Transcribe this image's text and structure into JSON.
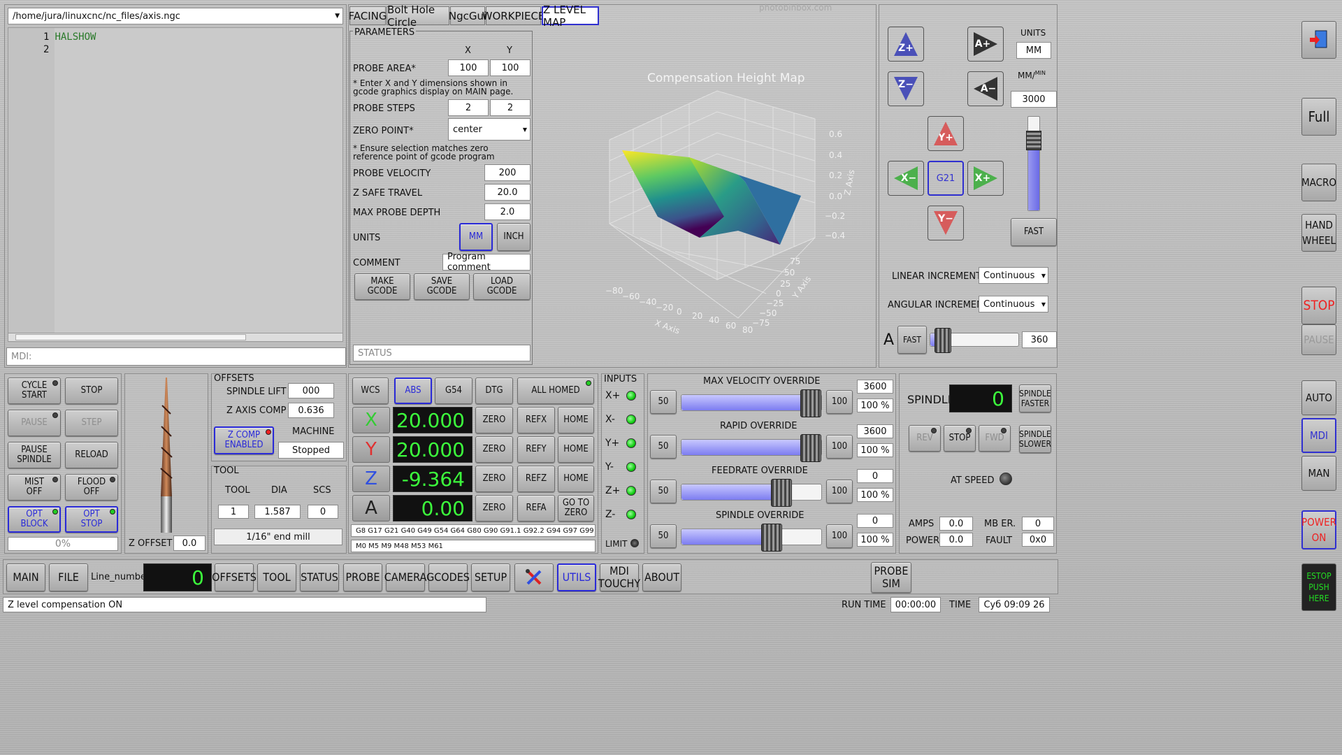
{
  "editor": {
    "path": "/home/jura/linuxcnc/nc_files/axis.ngc",
    "line1_num": "1",
    "line1_text": "HALSHOW",
    "line2_num": "2",
    "mdi_placeholder": "MDI:"
  },
  "tabs": [
    "FACING",
    "Bolt Hole Circle",
    "NgcGui",
    "WORKPIECE",
    "Z LEVEL MAP"
  ],
  "params": {
    "header": "PARAMETERS",
    "col_x": "X",
    "col_y": "Y",
    "probe_area_label": "PROBE AREA*",
    "probe_area_x": "100",
    "probe_area_y": "100",
    "note1": "* Enter X and Y dimensions shown in gcode graphics display on MAIN page.",
    "probe_steps_label": "PROBE STEPS",
    "probe_steps_x": "2",
    "probe_steps_y": "2",
    "zero_point_label": "ZERO POINT*",
    "zero_point_value": "center",
    "note2": "* Ensure selection matches zero reference point of gcode program",
    "probe_velocity_label": "PROBE VELOCITY",
    "probe_velocity": "200",
    "z_safe_label": "Z SAFE TRAVEL",
    "z_safe": "20.0",
    "max_depth_label": "MAX PROBE DEPTH",
    "max_depth": "2.0",
    "units_label": "UNITS",
    "mm": "MM",
    "inch": "INCH",
    "comment_label": "COMMENT",
    "comment_value": "Program comment",
    "make": "MAKE\nGCODE",
    "save": "SAVE\nGCODE",
    "load": "LOAD\nGCODE",
    "status_placeholder": "STATUS"
  },
  "plot": {
    "title": "Compensation Height Map",
    "watermark": "photobinbox.com",
    "z_axis": "Z Axis",
    "y_axis": "Y Axis",
    "x_axis": "X Axis",
    "z_ticks": [
      "0.6",
      "0.4",
      "0.2",
      "0.0",
      "−0.2",
      "−0.4"
    ],
    "x_ticks": [
      "−80",
      "−60",
      "−40",
      "−20",
      "0",
      "20",
      "40",
      "60",
      "80"
    ],
    "y_ticks": [
      "75",
      "50",
      "25",
      "0",
      "−25",
      "−50",
      "−75"
    ]
  },
  "jog": {
    "z_plus": "Z+",
    "z_minus": "Z−",
    "a_plus": "A+",
    "a_minus": "A−",
    "y_plus": "Y+",
    "y_minus": "Y−",
    "x_plus": "X+",
    "x_minus": "X−",
    "g21": "G21",
    "units_label": "UNITS",
    "units_value": "MM",
    "rate_label": "MM/",
    "rate_sup": "MIN",
    "rate_value": "3000",
    "fast": "FAST",
    "linear_label": "LINEAR INCREMENT",
    "linear_value": "Continuous",
    "angular_label": "ANGULAR INCREMENT",
    "angular_value": "Continuous",
    "a_label": "A",
    "a_fast": "FAST",
    "a_value": "360"
  },
  "side": {
    "full": "Full",
    "macro": "MACRO",
    "handwheel": "HAND\nWHEEL",
    "stop": "STOP",
    "pause": "PAUSE",
    "auto": "AUTO",
    "mdi": "MDI",
    "man": "MAN",
    "power": "POWER\nON",
    "estop": "ESTOP\nPUSH\nHERE"
  },
  "controls": {
    "cycle_start": "CYCLE\nSTART",
    "stop": "STOP",
    "pause": "PAUSE",
    "step": "STEP",
    "pause_spindle": "PAUSE\nSPINDLE",
    "reload": "RELOAD",
    "mist": "MIST\nOFF",
    "flood": "FLOOD\nOFF",
    "opt_block": "OPT\nBLOCK",
    "opt_stop": "OPT\nSTOP",
    "progress": "0%",
    "z_offset_label": "Z OFFSET",
    "z_offset": "0.0"
  },
  "offsets": {
    "header": "OFFSETS",
    "spindle_lift_label": "SPINDLE LIFT",
    "spindle_lift": "000",
    "z_comp_label": "Z AXIS COMP",
    "z_comp": "0.636",
    "z_comp_btn": "Z COMP\nENABLED",
    "machine_label": "MACHINE",
    "machine_state": "Stopped",
    "tool_header": "TOOL",
    "tool_col": "TOOL",
    "dia_col": "DIA",
    "scs_col": "SCS",
    "tool": "1",
    "dia": "1.587",
    "scs": "0",
    "tool_desc": "1/16\" end mill"
  },
  "dro": {
    "wcs": "WCS",
    "abs": "ABS",
    "g54": "G54",
    "dtg": "DTG",
    "homed": "ALL HOMED",
    "axes": [
      {
        "name": "X",
        "value": "20.000",
        "ref": "REFX",
        "home": "HOME",
        "color": "#33cc33"
      },
      {
        "name": "Y",
        "value": "20.000",
        "ref": "REFY",
        "home": "HOME",
        "color": "#e03030"
      },
      {
        "name": "Z",
        "value": "-9.364",
        "ref": "REFZ",
        "home": "HOME",
        "color": "#3050e0"
      },
      {
        "name": "A",
        "value": "0.00",
        "ref": "REFA",
        "home": "GO TO\nZERO",
        "color": "#222222"
      }
    ],
    "zero": "ZERO",
    "gcodes": "G8 G17 G21 G40 G49 G54 G64 G80 G90 G91.1 G92.2 G94 G97 G99",
    "mcodes": "M0 M5 M9 M48 M53 M61"
  },
  "inputs": {
    "header": "INPUTS",
    "items": [
      "X+",
      "X-",
      "Y+",
      "Y-",
      "Z+",
      "Z-"
    ],
    "limit": "LIMIT"
  },
  "overrides": [
    {
      "label": "MAX VELOCITY OVERRIDE",
      "value": "3600",
      "pct": "100 %",
      "level": 1.0
    },
    {
      "label": "RAPID OVERRIDE",
      "value": "3600",
      "pct": "100 %",
      "level": 1.0
    },
    {
      "label": "FEEDRATE OVERRIDE",
      "value": "0",
      "pct": "100 %",
      "level": 0.76
    },
    {
      "label": "SPINDLE OVERRIDE",
      "value": "0",
      "pct": "100 %",
      "level": 0.68
    }
  ],
  "ov_btn_low": "50",
  "ov_btn_high": "100",
  "spindle": {
    "label": "SPINDLE",
    "display": "0",
    "faster": "SPINDLE\nFASTER",
    "slower": "SPINDLE\nSLOWER",
    "rev": "REV",
    "stop": "STOP",
    "fwd": "FWD",
    "at_speed": "AT SPEED",
    "amps_label": "AMPS",
    "amps": "0.0",
    "power_label": "POWER",
    "power": "0.0",
    "mb_label": "MB ER.",
    "mb": "0",
    "fault_label": "FAULT",
    "fault": "0x0"
  },
  "bottom": {
    "main": "MAIN",
    "file": "FILE",
    "line_label": "Line_number",
    "line_value": "0",
    "offsets": "OFFSETS",
    "tool": "TOOL",
    "status": "STATUS",
    "probe": "PROBE",
    "camera": "CAMERA",
    "gcodes": "GCODES",
    "setup": "SETUP",
    "utils": "UTILS",
    "mdi_touchy": "MDI\nTOUCHY",
    "about": "ABOUT",
    "probe_sim": "PROBE\nSIM"
  },
  "statusbar": {
    "message": "Z level compensation ON",
    "run_time_label": "RUN TIME",
    "run_time": "00:00:00",
    "time_label": "TIME",
    "time": "Суб 09:09 26"
  }
}
